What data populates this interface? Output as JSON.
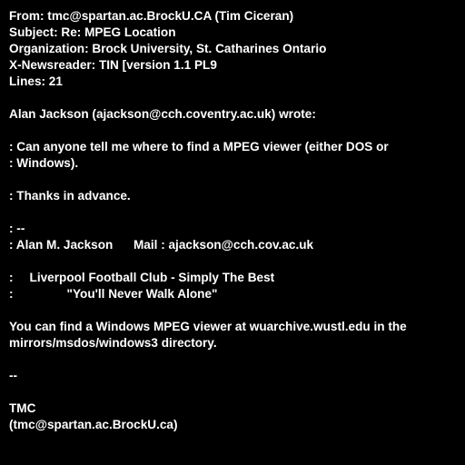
{
  "colors": {
    "background": "#000000",
    "text": "#ffffff"
  },
  "headers": {
    "from": "From: tmc@spartan.ac.BrockU.CA (Tim Ciceran)",
    "subject": "Subject: Re: MPEG Location",
    "organization": "Organization: Brock University, St. Catharines Ontario",
    "newsreader": "X-Newsreader: TIN [version 1.1 PL9",
    "lines": "Lines: 21"
  },
  "body": {
    "attribution": "Alan Jackson (ajackson@cch.coventry.ac.uk) wrote:",
    "quote_question_1": ": Can anyone tell me where to find a MPEG viewer (either DOS or",
    "quote_question_2": ": Windows).",
    "quote_thanks": ": Thanks in advance.",
    "quote_sig_separator": ": --",
    "quote_sig_name": ": Alan M. Jackson      Mail : ajackson@cch.cov.ac.uk",
    "quote_sig_club_prefix": ":",
    "quote_sig_club": "Liverpool Football Club - Simply The Best",
    "quote_sig_motto_prefix": ":",
    "quote_sig_motto": "\"You'll Never Walk Alone\"",
    "answer_1": "You can find a Windows MPEG viewer at wuarchive.wustl.edu in the",
    "answer_2": "mirrors/msdos/windows3 directory.",
    "sig_separator": "--",
    "sig_name": "TMC",
    "sig_email": "(tmc@spartan.ac.BrockU.ca)"
  }
}
